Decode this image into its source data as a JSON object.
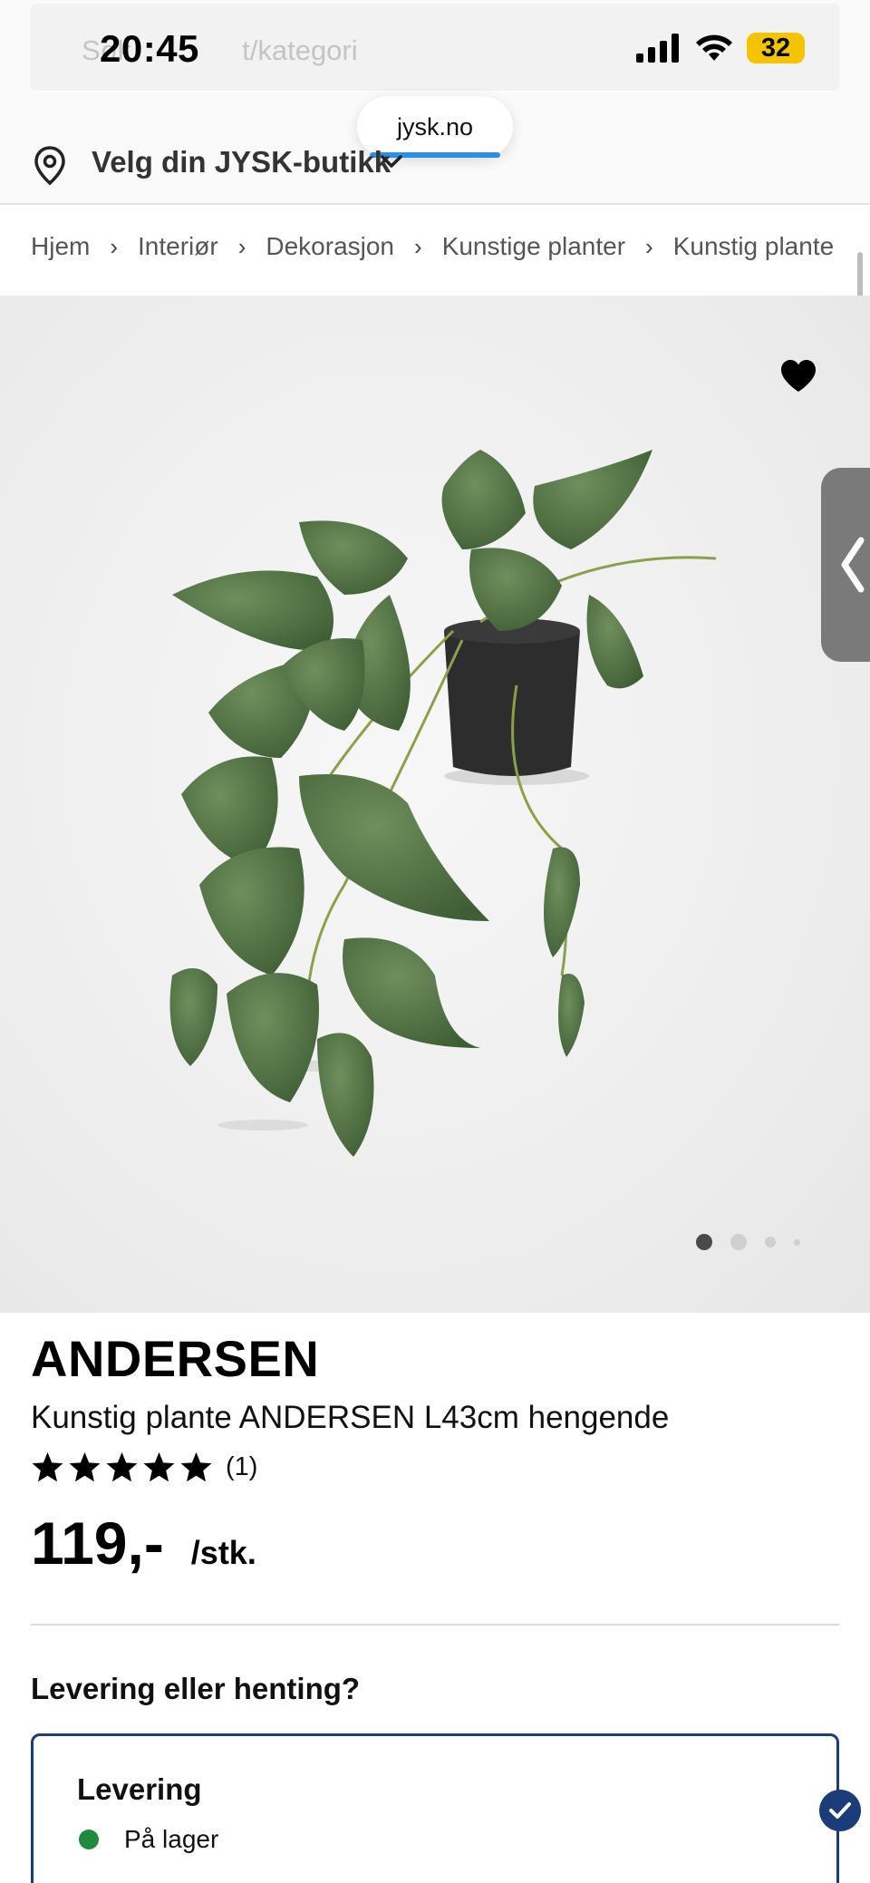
{
  "status_bar": {
    "time": "20:45",
    "battery": "32"
  },
  "search": {
    "placeholder": "Søk etter produkt/kategori",
    "visible_placeholder_left": "Søk",
    "visible_placeholder_right": "t/kategori"
  },
  "browser": {
    "url": "jysk.no"
  },
  "store": {
    "label": "Velg din JYSK-butikk"
  },
  "breadcrumb": [
    "Hjem",
    "Interiør",
    "Dekorasjon",
    "Kunstige planter",
    "Kunstig plante"
  ],
  "gallery": {
    "image_count": 4,
    "active_index": 0
  },
  "product": {
    "brand": "ANDERSEN",
    "title": "Kunstig plante ANDERSEN L43cm hengende",
    "rating_stars": 5,
    "rating_count": "(1)",
    "price": "119,-",
    "price_unit": "/stk."
  },
  "delivery": {
    "heading": "Levering eller henting?",
    "option_title": "Levering",
    "stock_status": "På lager"
  },
  "colors": {
    "accent": "#1c3b79",
    "in_stock": "#1f8a3c",
    "url_progress": "#2d8ee8",
    "battery": "#f5c400"
  }
}
